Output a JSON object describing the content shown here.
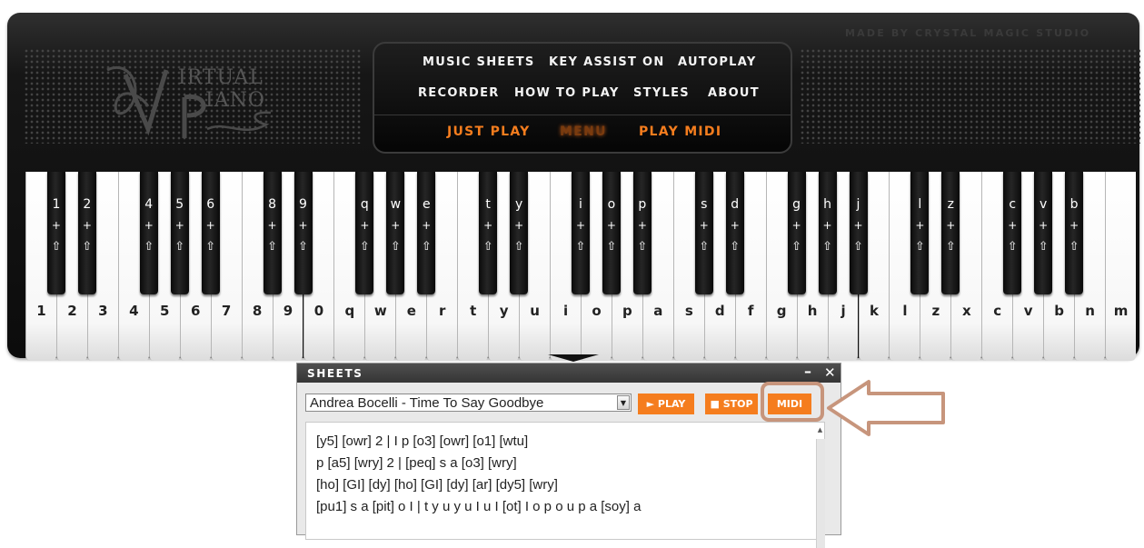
{
  "header": {
    "studio": "MADE BY CRYSTAL MAGIC STUDIO",
    "logo_line1": "IRTUAL",
    "logo_line2": "IANO"
  },
  "menu": {
    "row1": [
      "MUSIC SHEETS",
      "KEY ASSIST ON",
      "AUTOPLAY"
    ],
    "row2": [
      "RECORDER",
      "HOW TO PLAY",
      "STYLES",
      "ABOUT"
    ],
    "row3": [
      "JUST PLAY",
      "MENU",
      "PLAY MIDI"
    ]
  },
  "keyboard": {
    "white_keys": [
      "1",
      "2",
      "3",
      "4",
      "5",
      "6",
      "7",
      "8",
      "9",
      "0",
      "q",
      "w",
      "e",
      "r",
      "t",
      "y",
      "u",
      "i",
      "o",
      "p",
      "a",
      "s",
      "d",
      "f",
      "g",
      "h",
      "j",
      "k",
      "l",
      "z",
      "x",
      "c",
      "v",
      "b",
      "n",
      "m"
    ],
    "black_keys": [
      "1",
      "2",
      "4",
      "5",
      "6",
      "8",
      "9",
      "q",
      "w",
      "e",
      "t",
      "y",
      "i",
      "o",
      "p",
      "s",
      "d",
      "g",
      "h",
      "j",
      "l",
      "z",
      "c",
      "v",
      "b"
    ],
    "black_plus": "+",
    "black_shift": "⇧"
  },
  "sheets": {
    "title": "SHEETS",
    "minimize": "–",
    "close": "✕",
    "selected_song": "Andrea Bocelli - Time To Say Goodbye",
    "play_label": "► PLAY",
    "stop_label": "■ STOP",
    "midi_label": "MIDI",
    "lines": [
      "[y5] [owr] 2 | I p [o3] [owr] [o1] [wtu]",
      "p [a5] [wry] 2 | [peq] s a [o3] [wry]",
      "[ho] [GI] [dy] [ho] [GI] [dy] [ar] [dy5] [wry]",
      "[pu1] s a [pit] o I | t y u y u I u I [ot] I o p o u p a [soy] a"
    ]
  },
  "colors": {
    "accent": "#f57d1e",
    "highlight": "#c7957c",
    "case": "#111111"
  }
}
